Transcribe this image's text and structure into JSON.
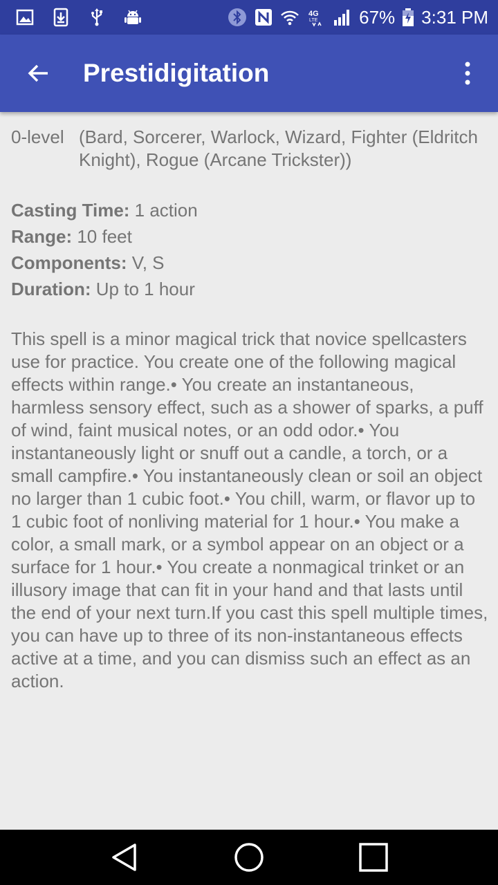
{
  "status_bar": {
    "battery": "67%",
    "time": "3:31 PM",
    "icons": [
      "image-icon",
      "download-icon",
      "usb-icon",
      "android-icon",
      "bluetooth-icon",
      "nfc-icon",
      "wifi-icon",
      "4g-lte-icon",
      "signal-icon",
      "battery-charging-icon"
    ]
  },
  "app_bar": {
    "title": "Prestidigitation",
    "icons": [
      "back-arrow-icon",
      "more-vert-icon"
    ]
  },
  "spell": {
    "level": "0-level",
    "classes": "(Bard, Sorcerer, Warlock, Wizard, Fighter (Eldritch Knight), Rogue (Arcane Trickster))",
    "casting_time_label": "Casting Time:",
    "casting_time": " 1 action",
    "range_label": "Range:",
    "range": " 10 feet",
    "components_label": "Components:",
    "components": " V, S",
    "duration_label": "Duration:",
    "duration": " Up to 1 hour",
    "description": "This spell is a minor magical trick that novice spellcasters use for practice. You create one of the following magical effects within range.• You create an instantaneous, harmless sensory effect, such as a shower of sparks, a puff of wind, faint musical notes, or an odd odor.• You instantaneously light or snuff out a candle, a torch, or a small campfire.• You instantaneously clean or soil an object no larger than 1 cubic foot.• You chill, warm, or flavor up to 1 cubic foot of nonliving material for 1 hour.• You make a color, a small mark, or a symbol appear on an object or a surface for 1 hour.• You create a nonmagical trinket or an illusory image that can fit in your hand and that lasts until the end of your next turn.If you cast this spell multiple times, you can have up to three of its non-instantaneous effects active at a time, and you can dismiss such an effect as an action."
  },
  "nav_bar": {
    "icons": [
      "back-triangle-icon",
      "home-circle-icon",
      "recents-square-icon"
    ]
  },
  "colors": {
    "status_bar": "#2f3e9e",
    "app_bar": "#3f51b5",
    "background": "#ececec",
    "text": "#757575"
  }
}
